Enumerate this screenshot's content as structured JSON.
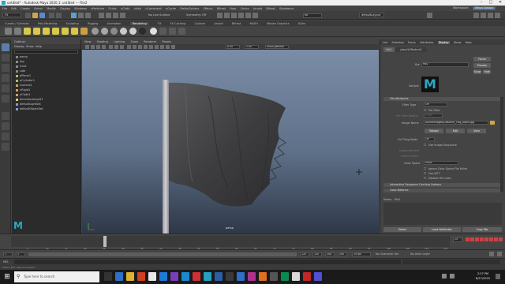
{
  "window": {
    "title": "untitled* - Autodesk Maya 2020.1: untitled  ---  File2"
  },
  "menubar": {
    "items": [
      "File",
      "Edit",
      "Create",
      "Select",
      "Modify",
      "Display",
      "Windows",
      "nParticles",
      "Fluids",
      "nCloth",
      "nHair",
      "nConstraint",
      "nCache",
      "Fields/Solvers",
      "Effects",
      "Bifrost",
      "Help",
      "Cache",
      "Arnold",
      "Bifrost",
      "Substance"
    ],
    "workspace_label": "Workspace:",
    "workspace_value": "Maya Classic"
  },
  "status": {
    "mode": "FX",
    "symmetry": "Symmetry: Off",
    "no_live": "No Live Surface",
    "render_field": "fla",
    "camera": "defaultLayout"
  },
  "shelf": {
    "tabs": [
      "Curves / Surfaces",
      "Poly Modeling",
      "Sculpting",
      "Rigging",
      "Animation",
      "Rendering",
      "FX",
      "FX Caching",
      "Custom",
      "Arnold",
      "Bifrost",
      "MASH",
      "Motion Graphics",
      "XGen"
    ],
    "active": "Rendering"
  },
  "outliner": {
    "title": "Outliner",
    "menu": [
      "Display",
      "Show",
      "Help"
    ],
    "items": [
      {
        "label": "persp",
        "color": "#8a8a8a"
      },
      {
        "label": "top",
        "color": "#8a8a8a"
      },
      {
        "label": "front",
        "color": "#8a8a8a"
      },
      {
        "label": "side",
        "color": "#8a8a8a"
      },
      {
        "label": "pPlane1",
        "color": "#9bc26b"
      },
      {
        "label": "pCylinder1",
        "color": "#9bc26b"
      },
      {
        "label": "nucleus1",
        "color": "#d0a060"
      },
      {
        "label": "nRigid1",
        "color": "#d0a060"
      },
      {
        "label": "nCloth1",
        "color": "#d0a060"
      },
      {
        "label": "directionalLight1",
        "color": "#e0d070"
      },
      {
        "label": "defaultLightSet",
        "color": "#7fa0d0"
      },
      {
        "label": "defaultObjectSet",
        "color": "#7fa0d0"
      }
    ]
  },
  "viewport": {
    "menu": [
      "View",
      "Shading",
      "Lighting",
      "Show",
      "Renderer",
      "Panels"
    ],
    "camera_label": "persp",
    "field_a": "0.00",
    "field_b": "1.00",
    "color_space": "sRGB gamma"
  },
  "attr_editor": {
    "tabs": [
      "List",
      "Selected",
      "Focus",
      "Attributes",
      "Display",
      "Show",
      "Help"
    ],
    "active_tab": "Display",
    "node_tabs": [
      "file2",
      "place2dTexture2"
    ],
    "file_label": "file:",
    "file_value": "file2",
    "focus_btn": "Focus",
    "presets_btn": "Presets",
    "show_btn": "Show",
    "hide_btn": "Hide",
    "sample_label": "Sample",
    "section_file": "File Attributes",
    "filter_type_label": "Filter Type",
    "filter_type_value": "Off",
    "pre_filter_label": "Pre Filter",
    "pre_filter_radius_label": "Pre Filter Radius",
    "pre_filter_radius_value": "2.000",
    "image_name_label": "Image Name",
    "image_name_value": "sourceimages/Distance_Flag_Alpha.jpg",
    "reload_btn": "Reload",
    "edit_btn": "Edit",
    "view_btn": "View",
    "uv_tiling_label": "UV Tiling Mode",
    "uv_tiling_value": "Off",
    "use_image_seq_label": "Use Image Sequence",
    "image_number_label": "Image Number",
    "frame_offset_label": "Frame Offset",
    "color_space_label": "Color Space",
    "color_space_value": "sRGB",
    "ignore_cs_label": "Ignore Color Space File Rules",
    "use_bot_label": "Use BOT",
    "disable_file_load_label": "Disable File Load",
    "section_interactive": "Interactive Sequence Caching Options",
    "section_color": "Color Balance",
    "notes_label": "Notes:",
    "notes_value": "file2",
    "select_btn": "Select",
    "load_btn": "Load Attributes",
    "copy_btn": "Copy Tab"
  },
  "timeline": {
    "ticks": [
      "5",
      "10",
      "15",
      "20",
      "25",
      "30",
      "35",
      "40",
      "45",
      "50",
      "55",
      "60",
      "65",
      "70",
      "75",
      "80",
      "85",
      "90",
      "95",
      "100",
      "105",
      "110",
      "115"
    ],
    "current_frame": "14",
    "range_start": "1",
    "range_start2": "1",
    "range_end": "120",
    "range_end2": "120",
    "range_end3": "200",
    "range_end4": "200",
    "fps": "24 fps",
    "char_set": "No Character Set",
    "anim_layer": "No Anim Layer"
  },
  "cmdline": {
    "label": "MEL"
  },
  "helpline": {
    "text": "Select Tool: select an object"
  },
  "taskbar": {
    "search_placeholder": "Type here to search",
    "time": "2:57 PM",
    "date": "8/27/2020"
  }
}
